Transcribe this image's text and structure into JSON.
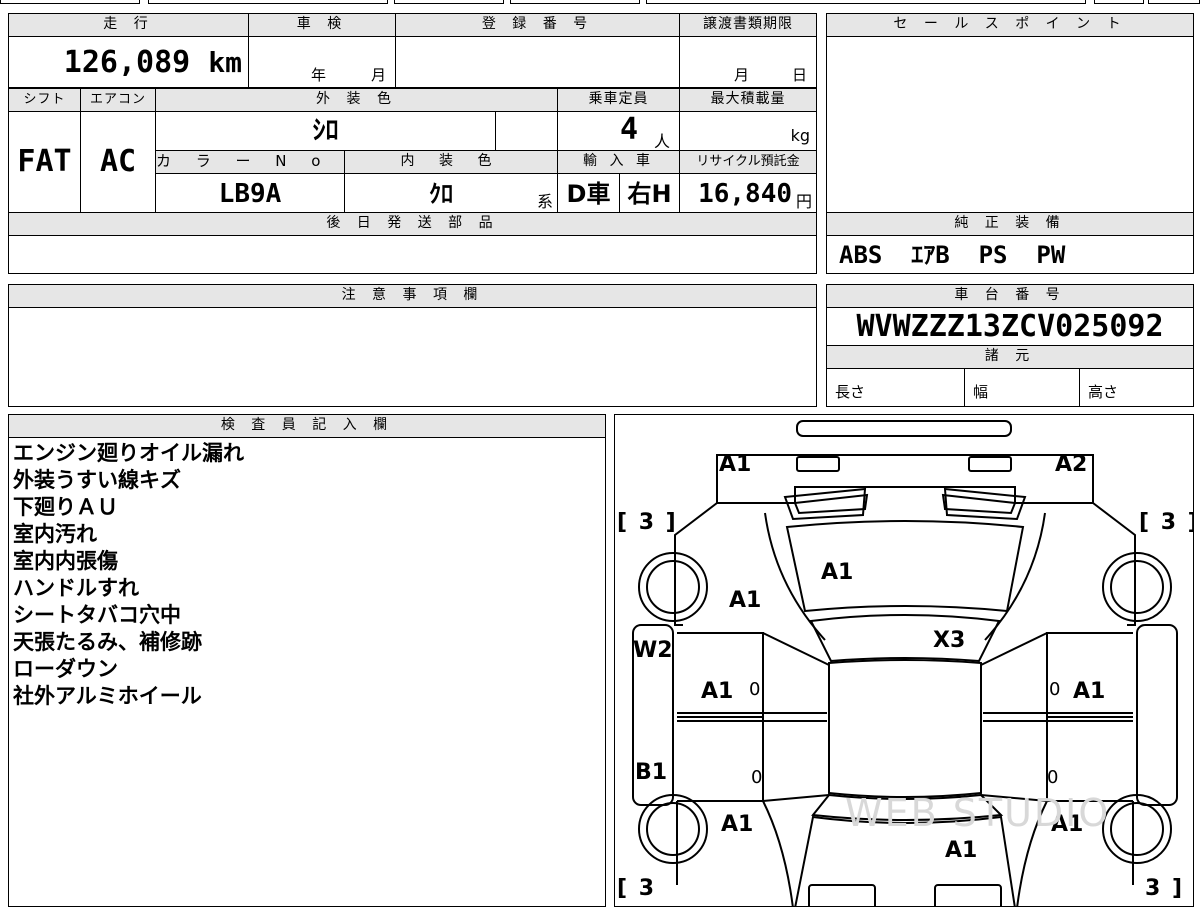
{
  "mileage": {
    "header": "走 行",
    "value": "126,089",
    "unit": "km"
  },
  "inspection": {
    "header": "車 検",
    "year_label": "年",
    "month_label": "月"
  },
  "registration": {
    "header": "登 録 番 号",
    "value": ""
  },
  "transfer_deadline": {
    "header": "譲渡書類期限",
    "month_label": "月",
    "day_label": "日"
  },
  "sales_point": {
    "header": "セ ー ル ス ポ イ ン ト",
    "value": ""
  },
  "shift": {
    "header": "シフト",
    "value": "FAT"
  },
  "aircon": {
    "header": "エアコン",
    "value": "AC"
  },
  "exterior_color": {
    "header": "外 装 色",
    "value": "ｼﾛ"
  },
  "capacity": {
    "header": "乗車定員",
    "value": "4",
    "unit": "人"
  },
  "max_load": {
    "header": "最大積載量",
    "unit": "kg"
  },
  "color_no": {
    "header": "カ ラ ー N o .",
    "value": "LB9A"
  },
  "interior_color": {
    "header": "内 装 色",
    "value": "ｸﾛ",
    "suffix": "系"
  },
  "import": {
    "header": "輸 入 車",
    "dealer": "D車",
    "steering": "右H"
  },
  "recycle_fee": {
    "header": "リサイクル預託金",
    "value": "16,840",
    "unit": "円"
  },
  "later_parts": {
    "header": "後 日 発 送 部 品",
    "value": ""
  },
  "genuine_equipment": {
    "header": "純 正 装 備",
    "value": "ABS  ｴｱB  PS  PW"
  },
  "notes": {
    "header": "注 意 事 項 欄",
    "value": ""
  },
  "chassis_no": {
    "header": "車 台 番 号",
    "value": "WVWZZZ13ZCV025092"
  },
  "specs": {
    "header": "諸 元",
    "length_label": "長さ",
    "width_label": "幅",
    "height_label": "高さ"
  },
  "inspector": {
    "header": "検 査 員 記 入 欄",
    "lines": [
      "エンジン廻りオイル漏れ",
      "外装うすい線キズ",
      "下廻りＡＵ",
      "室内汚れ",
      "室内内張傷",
      "ハンドルすれ",
      "シートタバコ穴中",
      "天張たるみ、補修跡",
      "ローダウン",
      "社外アルミホイール"
    ]
  },
  "diagram": {
    "front_left": "A1",
    "front_right": "A2",
    "hood": "A1",
    "fender_left": "A1",
    "roof": "X3",
    "pillar_left": "W2",
    "front_door_left": "A1",
    "front_door_right": "A1",
    "sill_left": "B1",
    "rear_fender_left": "A1",
    "rear_fender_right": "A1",
    "trunk": "A1",
    "tire_tl": "[ 3 ]",
    "tire_tr": "[ 3 ]",
    "tire_bl": "[ 3",
    "tire_br": "3 ]",
    "door_zero": "0",
    "watermark": "WEB STUDIO"
  }
}
